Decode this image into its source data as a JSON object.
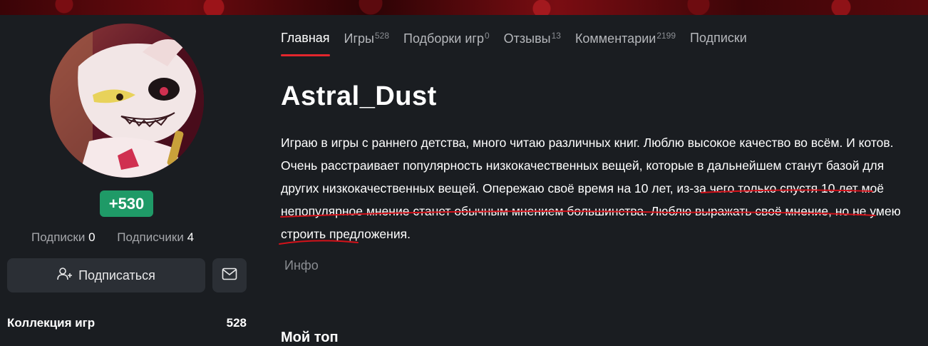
{
  "sidebar": {
    "karma": "+530",
    "subscriptions_label": "Подписки",
    "subscriptions_count": "0",
    "subscribers_label": "Подписчики",
    "subscribers_count": "4",
    "subscribe_button_label": "Подписаться",
    "collection_label": "Коллекция игр",
    "collection_count": "528"
  },
  "tabs": [
    {
      "label": "Главная",
      "count": ""
    },
    {
      "label": "Игры",
      "count": "528"
    },
    {
      "label": "Подборки игр",
      "count": "0"
    },
    {
      "label": "Отзывы",
      "count": "13"
    },
    {
      "label": "Комментарии",
      "count": "2199"
    },
    {
      "label": "Подписки",
      "count": ""
    }
  ],
  "profile": {
    "username": "Astral_Dust",
    "bio_part1": "Играю в игры с раннего детства, много читаю различных книг. Люблю высокое качество во всём. И котов. Очень расстраивает популярность низкокачественных вещей, которые в дальнейшем станут базой для других низкокачественных вещей. ",
    "bio_part2": "Опережаю своё время на 10 лет, из-за чего только спустя 10 лет моё непопулярное мнение станет обычным мнением большинства",
    "bio_part3": ". Люблю выражать своё мнение, но не умею строить предложения.",
    "info_label": "Инфо",
    "my_top_label": "Мой топ"
  },
  "colors": {
    "accent": "#e3262d",
    "karma_bg": "#1f9a67",
    "background": "#1a1d21",
    "button_bg": "#2b2f35"
  },
  "icons": {
    "subscribe": "user-plus-icon",
    "mail": "envelope-icon"
  }
}
